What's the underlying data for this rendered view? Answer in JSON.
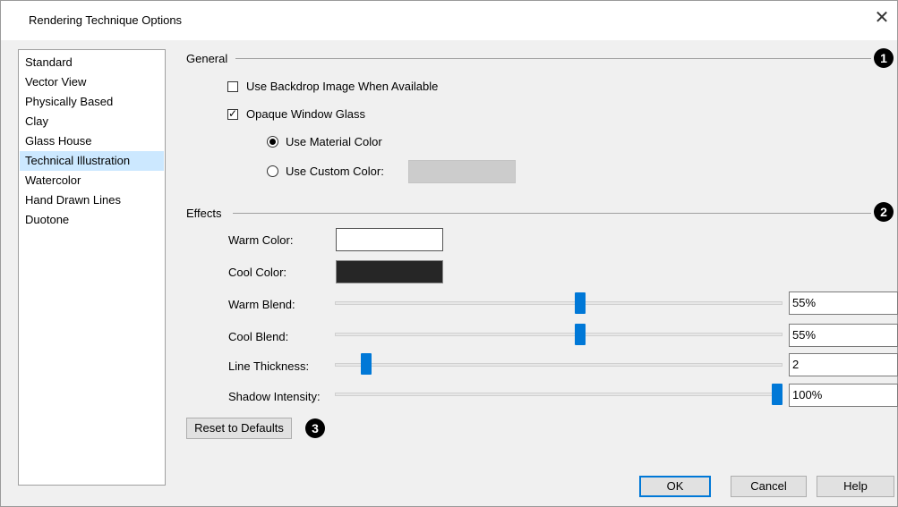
{
  "window": {
    "title": "Rendering Technique Options",
    "close_glyph": "✕"
  },
  "technique_list": {
    "items": [
      {
        "label": "Standard",
        "selected": false
      },
      {
        "label": "Vector View",
        "selected": false
      },
      {
        "label": "Physically Based",
        "selected": false
      },
      {
        "label": "Clay",
        "selected": false
      },
      {
        "label": "Glass House",
        "selected": false
      },
      {
        "label": "Technical Illustration",
        "selected": true
      },
      {
        "label": "Watercolor",
        "selected": false
      },
      {
        "label": "Hand Drawn Lines",
        "selected": false
      },
      {
        "label": "Duotone",
        "selected": false
      }
    ]
  },
  "general": {
    "heading": "General",
    "badge": "1",
    "use_backdrop": {
      "label": "Use Backdrop Image When Available",
      "checked": false
    },
    "opaque_glass": {
      "label": "Opaque Window Glass",
      "checked": true
    },
    "material_color": {
      "label": "Use Material Color",
      "selected": true
    },
    "custom_color": {
      "label": "Use Custom Color:",
      "selected": false,
      "swatch_color": "#cccccc"
    }
  },
  "effects": {
    "heading": "Effects",
    "badge": "2",
    "warm_color": {
      "label": "Warm Color:",
      "color": "#ffffff"
    },
    "cool_color": {
      "label": "Cool Color:",
      "color": "#262626"
    },
    "warm_blend": {
      "label": "Warm Blend:",
      "value": "55%",
      "fraction": 0.55
    },
    "cool_blend": {
      "label": "Cool Blend:",
      "value": "55%",
      "fraction": 0.55
    },
    "line_thickness": {
      "label": "Line Thickness:",
      "value": "2",
      "fraction": 0.06
    },
    "shadow_intensity": {
      "label": "Shadow Intensity:",
      "value": "100%",
      "fraction": 1.0
    }
  },
  "reset": {
    "label": "Reset to Defaults",
    "badge": "3"
  },
  "footer": {
    "ok": "OK",
    "cancel": "Cancel",
    "help": "Help"
  },
  "accent_color": "#0078d7"
}
